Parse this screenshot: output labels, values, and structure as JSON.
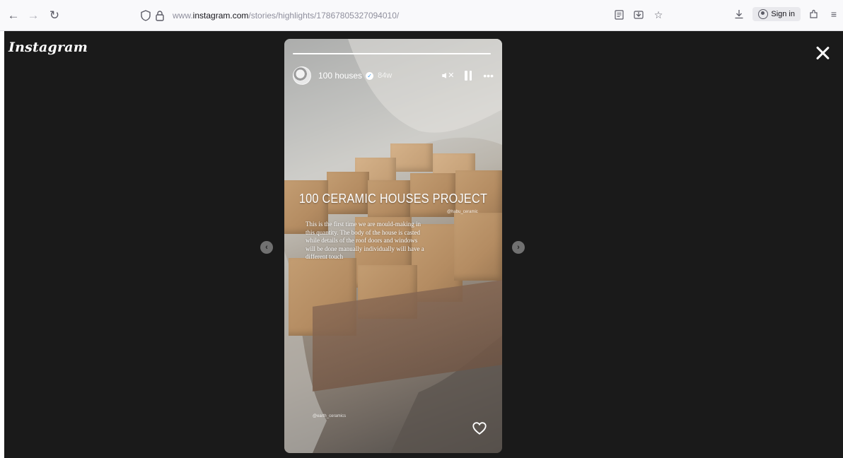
{
  "browser": {
    "url_prefix": "www.",
    "url_host": "instagram.com",
    "url_path": "/stories/highlights/17867805327094010/",
    "sign_in_label": "Sign in"
  },
  "viewer": {
    "logo_text": "Instagram",
    "prev_glyph": "‹",
    "next_glyph": "›"
  },
  "story": {
    "progress": 1.0,
    "username": "100 houses",
    "verified_glyph": "✓",
    "time_ago": "84w",
    "more_glyph": "•••",
    "mute_glyph": "✕",
    "title": "100 CERAMIC HOUSES PROJECT",
    "handle": "@habu_ceramic",
    "description": "This is the first time we are mould-making in this quantity. The body of the house is casted while details of the roof doors and windows will be done manually individually will have a different touch",
    "credit": "@earth_ceramics"
  },
  "colors": {
    "viewer_background": "#1a1a1a",
    "verified_blue": "#3797f0"
  }
}
